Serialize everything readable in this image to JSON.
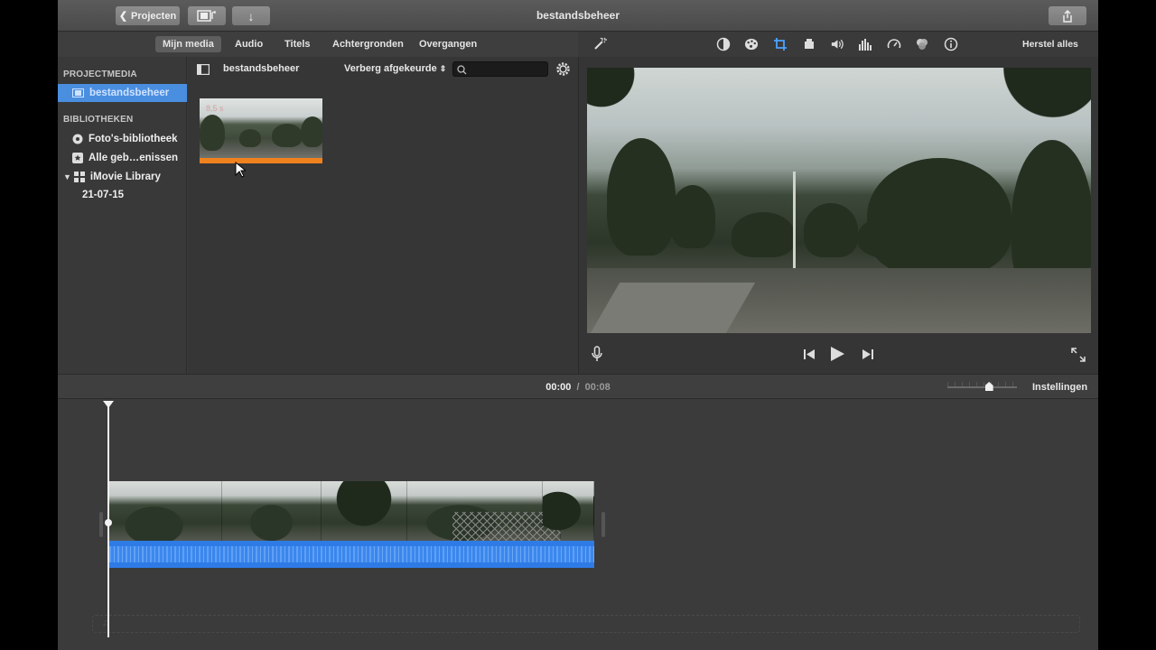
{
  "titlebar": {
    "projects_label": "Projecten",
    "title": "bestandsbeheer"
  },
  "tabs": [
    {
      "label": "Mijn media",
      "active": true
    },
    {
      "label": "Audio"
    },
    {
      "label": "Titels"
    },
    {
      "label": "Achtergronden"
    },
    {
      "label": "Overgangen"
    }
  ],
  "sidebar": {
    "project_media_header": "PROJECTMEDIA",
    "project_item": "bestandsbeheer",
    "libraries_header": "BIBLIOTHEKEN",
    "photos_library": "Foto's-bibliotheek",
    "all_events": "Alle geb…enissen",
    "imovie_library": "iMovie Library",
    "event_date": "21-07-15"
  },
  "browser": {
    "title": "bestandsbeheer",
    "filter_label": "Verberg afgekeurde",
    "search_value": "",
    "clip_duration": "8,5 s"
  },
  "viewer_toolbar": {
    "reset_all": "Herstel alles"
  },
  "timeline": {
    "current_time": "00:00",
    "separator": "/",
    "total_time": "00:08",
    "zoom_fraction": 0.6,
    "settings_label": "Instellingen"
  },
  "colors": {
    "accent": "#4a8ee0",
    "audio": "#2e7be6",
    "clip_bar": "#f0821e",
    "active_tool": "#4aa3ff"
  }
}
